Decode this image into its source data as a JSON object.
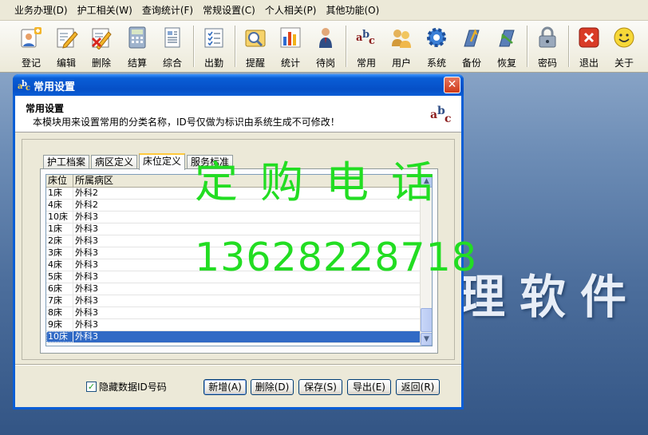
{
  "menu": [
    "业务办理(D)",
    "护工相关(W)",
    "查询统计(F)",
    "常规设置(C)",
    "个人相关(P)",
    "其他功能(O)"
  ],
  "toolbar": {
    "buttons": [
      {
        "label": "登记",
        "icon": "register-icon"
      },
      {
        "label": "编辑",
        "icon": "edit-icon"
      },
      {
        "label": "删除",
        "icon": "delete-icon"
      },
      {
        "label": "结算",
        "icon": "calculator-icon"
      },
      {
        "label": "综合",
        "icon": "document-icon"
      },
      {
        "label": "出勤",
        "icon": "attendance-list-icon"
      },
      {
        "label": "提醒",
        "icon": "reminder-icon"
      },
      {
        "label": "统计",
        "icon": "bar-chart-icon"
      },
      {
        "label": "待岗",
        "icon": "standby-person-icon"
      },
      {
        "label": "常用",
        "icon": "abc-icon"
      },
      {
        "label": "用户",
        "icon": "users-icon"
      },
      {
        "label": "系统",
        "icon": "gear-icon"
      },
      {
        "label": "备份",
        "icon": "backup-icon"
      },
      {
        "label": "恢复",
        "icon": "restore-icon"
      },
      {
        "label": "密码",
        "icon": "padlock-icon"
      },
      {
        "label": "退出",
        "icon": "exit-icon"
      },
      {
        "label": "关于",
        "icon": "smiley-icon"
      }
    ]
  },
  "background_text": "理软件",
  "dialog": {
    "title": "常用设置",
    "close_glyph": "✕",
    "header": {
      "title": "常用设置",
      "description": "本模块用来设置常用的分类名称，ID号仅做为标识由系统生成不可修改！"
    },
    "tabs": [
      "护工档案",
      "病区定义",
      "床位定义",
      "服务标准"
    ],
    "active_tab": "床位定义",
    "grid": {
      "columns": [
        "床位",
        "所属病区"
      ],
      "rows": [
        [
          "1床",
          "外科2"
        ],
        [
          "4床",
          "外科2"
        ],
        [
          "10床",
          "外科3"
        ],
        [
          "1床",
          "外科3"
        ],
        [
          "2床",
          "外科3"
        ],
        [
          "3床",
          "外科3"
        ],
        [
          "4床",
          "外科3"
        ],
        [
          "5床",
          "外科3"
        ],
        [
          "6床",
          "外科3"
        ],
        [
          "7床",
          "外科3"
        ],
        [
          "8床",
          "外科3"
        ],
        [
          "9床",
          "外科3"
        ],
        [
          "10床",
          "外科3"
        ]
      ],
      "selected_row": 12
    },
    "hide_id_checkbox": {
      "label": "隐藏数据ID号码",
      "checked": true
    },
    "buttons": {
      "add": "新增(A)",
      "delete": "删除(D)",
      "save": "保存(S)",
      "export": "导出(E)",
      "back": "返回(R)"
    }
  },
  "watermark": {
    "line1": "定购电话",
    "line2": "13628228718"
  },
  "colors": {
    "title_bar": "#0a5ed6",
    "selection": "#316ac5",
    "watermark": "#22dd22",
    "face": "#ece9d8"
  }
}
